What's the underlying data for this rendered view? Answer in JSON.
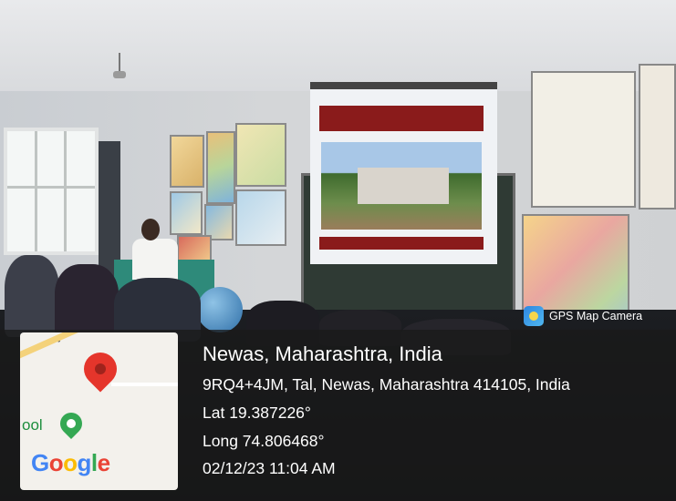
{
  "overlay": {
    "camera_badge": {
      "label": "GPS Map Camera",
      "icon": "gps-map-camera-icon"
    },
    "location": {
      "title": "Newas, Maharashtra, India",
      "address": "9RQ4+4JM, Tal, Newas, Maharashtra 414105, India",
      "lat": "Lat 19.387226°",
      "long": "Long 74.806468°",
      "datetime": "02/12/23 11:04 AM"
    },
    "map_thumbnail": {
      "partial_label": "ool",
      "brand": [
        "G",
        "o",
        "o",
        "g",
        "l",
        "e"
      ],
      "brand_colors": [
        "#4285F4",
        "#EA4335",
        "#FBBC05",
        "#4285F4",
        "#34A853",
        "#EA4335"
      ],
      "pin_color": "#E5352B",
      "place_pin_color": "#34A853"
    }
  }
}
